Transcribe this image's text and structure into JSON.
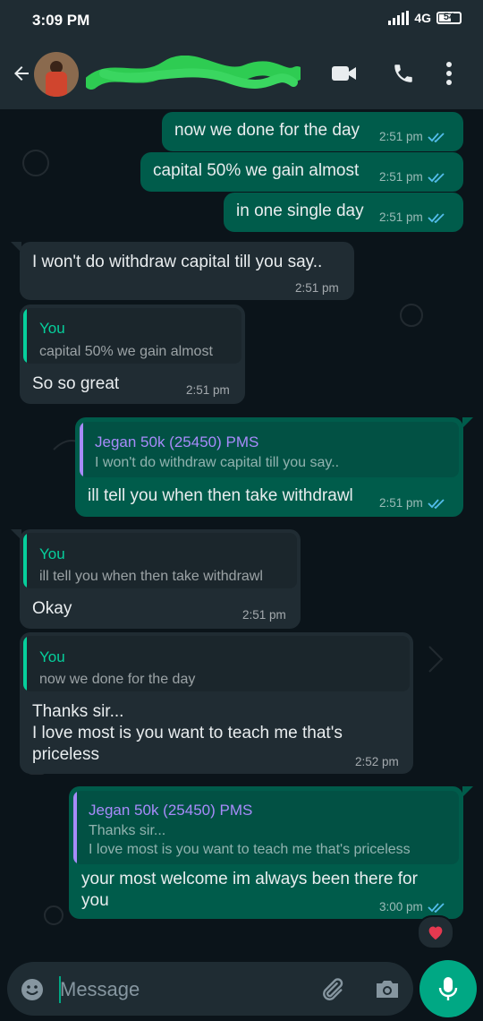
{
  "status_bar": {
    "time": "3:09 PM",
    "network": "4G",
    "battery": "54",
    "battery_level": 0.54
  },
  "header": {
    "contact_name_redacted": true,
    "icons": [
      "back-arrow-icon",
      "video-call-icon",
      "voice-call-icon",
      "more-options-icon"
    ]
  },
  "messages": [
    {
      "direction": "out",
      "text": "now we done for the day",
      "time": "2:51 pm",
      "status": "read"
    },
    {
      "direction": "out",
      "text": "capital 50% we gain almost",
      "time": "2:51 pm",
      "status": "read"
    },
    {
      "direction": "out",
      "text": "in one single day",
      "time": "2:51 pm",
      "status": "read"
    },
    {
      "direction": "in",
      "text": "I won't do withdraw capital till you say..",
      "time": "2:51 pm"
    },
    {
      "direction": "in",
      "reply_to": {
        "name": "You",
        "text": "capital 50% we gain almost"
      },
      "text": "So so great",
      "time": "2:51 pm"
    },
    {
      "direction": "out",
      "reply_to": {
        "name": "Jegan 50k (25450) PMS",
        "text": "I won't do withdraw capital till you say.."
      },
      "text": "ill tell you when then take withdrawl",
      "time": "2:51 pm",
      "status": "read"
    },
    {
      "direction": "in",
      "reply_to": {
        "name": "You",
        "text": "ill tell you when then take withdrawl"
      },
      "text": "Okay",
      "time": "2:51 pm"
    },
    {
      "direction": "in",
      "reply_to": {
        "name": "You",
        "text": "now we done for the day"
      },
      "lines": [
        "Thanks sir...",
        "I love most is you want to teach me that's",
        "priceless"
      ],
      "time": "2:52 pm"
    },
    {
      "direction": "out",
      "reply_to": {
        "name": "Jegan 50k (25450) PMS",
        "lines": [
          "Thanks sir...",
          "I love most is you want to teach me that's priceless"
        ]
      },
      "lines": [
        "your most welcome im always been there for",
        "you"
      ],
      "time": "3:00 pm",
      "status": "read",
      "reaction": "❤️"
    }
  ],
  "composer": {
    "placeholder": "Message"
  },
  "colors": {
    "outgoing_bubble": "#005c4b",
    "incoming_bubble": "#202c33",
    "you_reply_name": "#06cf9c",
    "contact_reply_name": "#a78bfa",
    "read_ticks": "#53bdeb",
    "accent": "#00a884"
  }
}
